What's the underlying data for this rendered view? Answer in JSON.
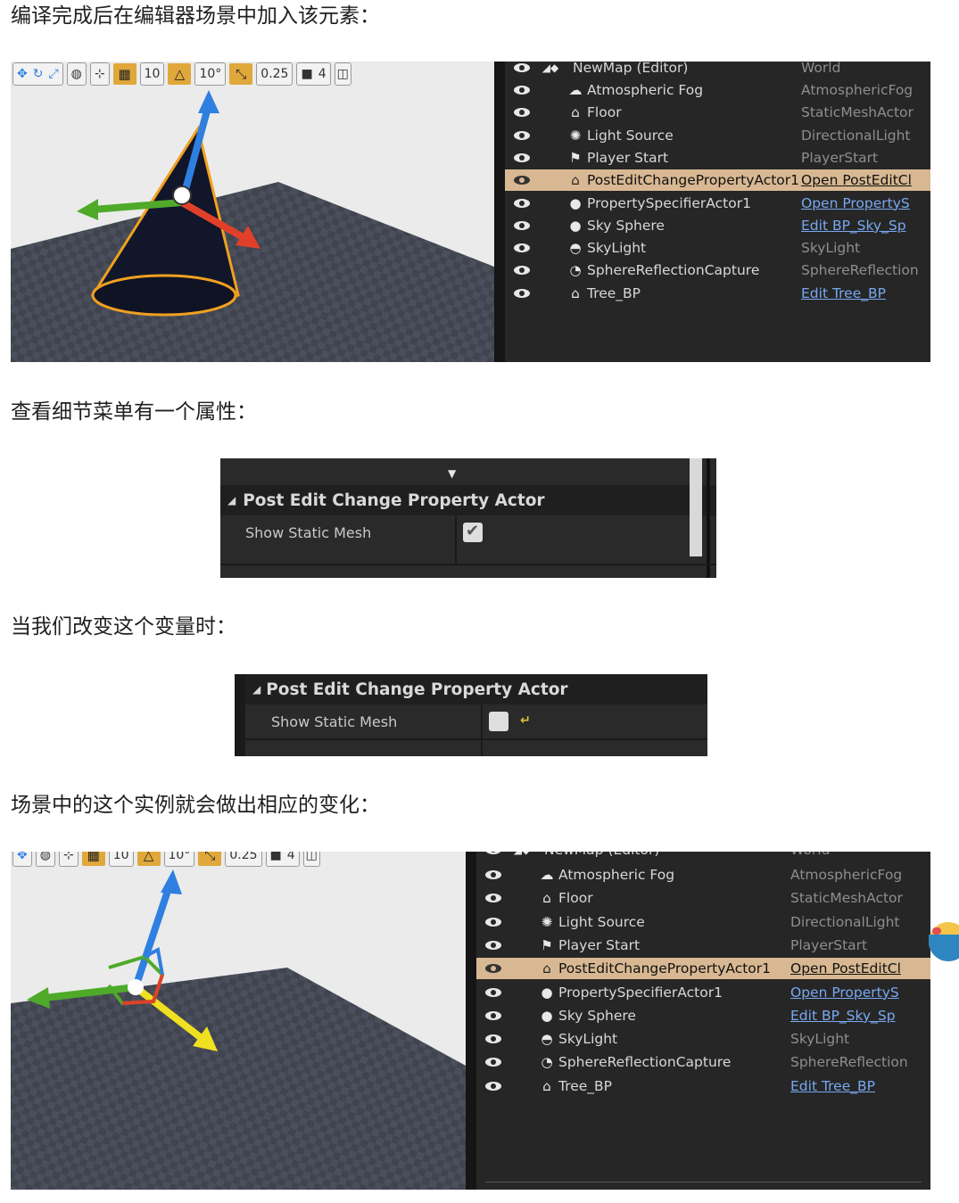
{
  "paragraphs": {
    "p1": "编译完成后在编辑器场景中加入该元素：",
    "p2": "查看细节菜单有一个属性：",
    "p3": "当我们改变这个变量时：",
    "p4": "场景中的这个实例就会做出相应的变化："
  },
  "toolbar": {
    "grid_snap": "10",
    "rotation_snap": "10°",
    "scale_snap": "0.25",
    "camera_speed": "4"
  },
  "outliner": {
    "root": {
      "label": "NewMap (Editor)",
      "type": "World"
    },
    "items": [
      {
        "label": "Atmospheric Fog",
        "type": "AtmosphericFog",
        "icon": "fog-icon",
        "link": false,
        "selected": false
      },
      {
        "label": "Floor",
        "type": "StaticMeshActor",
        "icon": "static-mesh-icon",
        "link": false,
        "selected": false
      },
      {
        "label": "Light Source",
        "type": "DirectionalLight",
        "icon": "directional-light-icon",
        "link": false,
        "selected": false
      },
      {
        "label": "Player Start",
        "type": "PlayerStart",
        "icon": "player-start-icon",
        "link": false,
        "selected": false
      },
      {
        "label": "PostEditChangePropertyActor1",
        "type": "Open PostEditCl",
        "icon": "blueprint-actor-icon",
        "link": true,
        "selected": true
      },
      {
        "label": "PropertySpecifierActor1",
        "type": "Open PropertyS",
        "icon": "sphere-icon",
        "link": true,
        "selected": false
      },
      {
        "label": "Sky Sphere",
        "type": "Edit BP_Sky_Sp",
        "icon": "sphere-icon",
        "link": true,
        "selected": false
      },
      {
        "label": "SkyLight",
        "type": "SkyLight",
        "icon": "skylight-icon",
        "link": false,
        "selected": false
      },
      {
        "label": "SphereReflectionCapture",
        "type": "SphereReflection",
        "icon": "reflection-capture-icon",
        "link": false,
        "selected": false
      },
      {
        "label": "Tree_BP",
        "type": "Edit Tree_BP",
        "icon": "blueprint-actor-icon",
        "link": true,
        "selected": false
      }
    ]
  },
  "details": {
    "category": "Post Edit Change Property Actor",
    "property": "Show Static Mesh",
    "before_checked": true,
    "after_checked": false
  },
  "colors": {
    "selection": "#d8b892",
    "link": "#78a8f0",
    "axis_x": "#e0402a",
    "axis_y": "#4faa2a",
    "axis_z": "#2f7fe0",
    "axis_active": "#f0e020",
    "cone_outline": "#f0a020"
  }
}
